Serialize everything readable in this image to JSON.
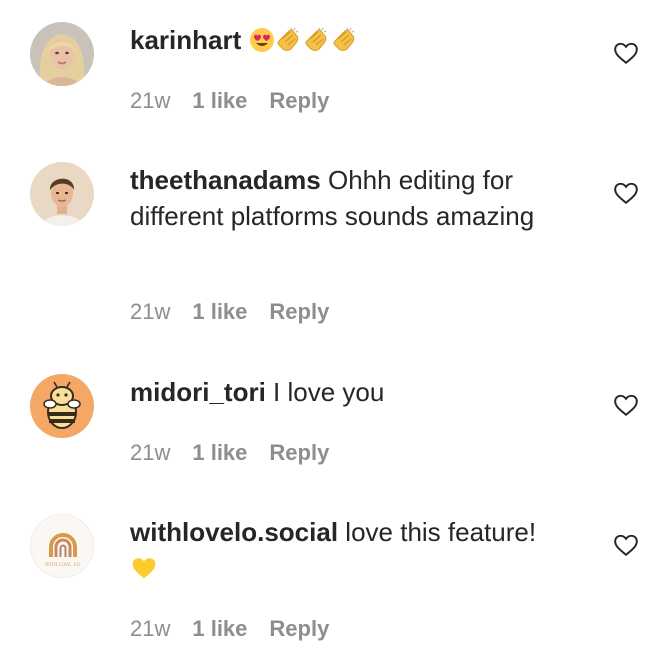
{
  "colors": {
    "text": "#262626",
    "muted": "#8e8e8e",
    "background": "#ffffff"
  },
  "comments": [
    {
      "username": "karinhart",
      "text": "",
      "emojis": [
        "smiling-face-with-heart-eyes",
        "clapping-hands",
        "clapping-hands",
        "clapping-hands"
      ],
      "time": "21w",
      "likes": "1 like",
      "reply": "Reply",
      "avatar": "avatar-blonde-woman"
    },
    {
      "username": "theethanadams",
      "text": "Ohhh editing for different platforms sounds amazing",
      "emojis": [],
      "time": "21w",
      "likes": "1 like",
      "reply": "Reply",
      "avatar": "avatar-young-man"
    },
    {
      "username": "midori_tori",
      "text": "I love you",
      "emojis": [],
      "time": "21w",
      "likes": "1 like",
      "reply": "Reply",
      "avatar": "avatar-cartoon-bee"
    },
    {
      "username": "withlovelo.social",
      "text": "love this feature!",
      "emojis": [
        "yellow-heart"
      ],
      "time": "21w",
      "likes": "1 like",
      "reply": "Reply",
      "avatar": "avatar-rainbow-logo",
      "avatar_logo_text": "WITH LOVE, LO."
    }
  ]
}
